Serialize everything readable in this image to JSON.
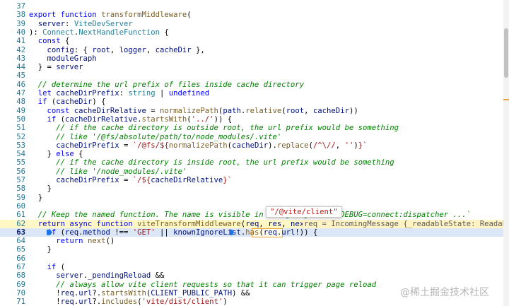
{
  "tooltip": {
    "text": "\"/@vite/client\""
  },
  "inline_value": "req = IncomingMessage {_readableState: ReadableSt",
  "watermark": "@稀土掘金技术社区",
  "icons": {
    "breakpoint": "breakpoint-arrow-icon",
    "scroll": "scrollbar"
  },
  "colors": {
    "keyword": "#0000ff",
    "function": "#795e26",
    "type": "#267f99",
    "identifier": "#001080",
    "string": "#a31515",
    "comment": "#008000",
    "line_number": "#237893",
    "current_line": "#dbe6f6",
    "paused_line": "#fff8c5"
  },
  "lines": [
    {
      "n": "37",
      "t": []
    },
    {
      "n": "38",
      "t": [
        [
          "kw",
          "export function "
        ],
        [
          "fn",
          "transformMiddleware"
        ],
        [
          "pl",
          "("
        ]
      ]
    },
    {
      "n": "39",
      "t": [
        [
          "pl",
          "  "
        ],
        [
          "id",
          "server"
        ],
        [
          "pl",
          ": "
        ],
        [
          "ty",
          "ViteDevServer"
        ]
      ]
    },
    {
      "n": "40",
      "t": [
        [
          "pl",
          "): "
        ],
        [
          "ty",
          "Connect"
        ],
        [
          "pl",
          "."
        ],
        [
          "ty",
          "NextHandleFunction"
        ],
        [
          "pl",
          " {"
        ]
      ]
    },
    {
      "n": "41",
      "t": [
        [
          "pl",
          "  "
        ],
        [
          "kw",
          "const"
        ],
        [
          "pl",
          " {"
        ]
      ]
    },
    {
      "n": "42",
      "t": [
        [
          "pl",
          "    "
        ],
        [
          "id",
          "config"
        ],
        [
          "pl",
          ": { "
        ],
        [
          "id",
          "root"
        ],
        [
          "pl",
          ", "
        ],
        [
          "id",
          "logger"
        ],
        [
          "pl",
          ", "
        ],
        [
          "id",
          "cacheDir"
        ],
        [
          "pl",
          " },"
        ]
      ]
    },
    {
      "n": "43",
      "t": [
        [
          "pl",
          "    "
        ],
        [
          "id",
          "moduleGraph"
        ]
      ]
    },
    {
      "n": "44",
      "t": [
        [
          "pl",
          "  } = "
        ],
        [
          "id",
          "server"
        ]
      ]
    },
    {
      "n": "45",
      "t": []
    },
    {
      "n": "46",
      "t": [
        [
          "pl",
          "  "
        ],
        [
          "cm",
          "// determine the url prefix of files inside cache directory"
        ]
      ]
    },
    {
      "n": "47",
      "t": [
        [
          "pl",
          "  "
        ],
        [
          "kw",
          "let "
        ],
        [
          "id",
          "cacheDirPrefix"
        ],
        [
          "pl",
          ": "
        ],
        [
          "ty",
          "string"
        ],
        [
          "pl",
          " | "
        ],
        [
          "kw",
          "undefined"
        ]
      ]
    },
    {
      "n": "48",
      "t": [
        [
          "pl",
          "  "
        ],
        [
          "kw",
          "if"
        ],
        [
          "pl",
          " ("
        ],
        [
          "id",
          "cacheDir"
        ],
        [
          "pl",
          ") {"
        ]
      ]
    },
    {
      "n": "49",
      "t": [
        [
          "pl",
          "    "
        ],
        [
          "kw",
          "const "
        ],
        [
          "id",
          "cacheDirRelative"
        ],
        [
          "pl",
          " = "
        ],
        [
          "fn",
          "normalizePath"
        ],
        [
          "pl",
          "("
        ],
        [
          "id",
          "path"
        ],
        [
          "pl",
          "."
        ],
        [
          "fn",
          "relative"
        ],
        [
          "pl",
          "("
        ],
        [
          "id",
          "root"
        ],
        [
          "pl",
          ", "
        ],
        [
          "id",
          "cacheDir"
        ],
        [
          "pl",
          "))"
        ]
      ]
    },
    {
      "n": "50",
      "t": [
        [
          "pl",
          "    "
        ],
        [
          "kw",
          "if"
        ],
        [
          "pl",
          " ("
        ],
        [
          "id",
          "cacheDirRelative"
        ],
        [
          "pl",
          "."
        ],
        [
          "fn",
          "startsWith"
        ],
        [
          "pl",
          "("
        ],
        [
          "str",
          "'../'"
        ],
        [
          "pl",
          ")) {"
        ]
      ]
    },
    {
      "n": "51",
      "t": [
        [
          "pl",
          "      "
        ],
        [
          "cm",
          "// if the cache directory is outside root, the url prefix would be something"
        ]
      ]
    },
    {
      "n": "52",
      "t": [
        [
          "pl",
          "      "
        ],
        [
          "cm",
          "// like '/@fs/absolute/path/to/node_modules/.vite'"
        ]
      ]
    },
    {
      "n": "53",
      "t": [
        [
          "pl",
          "      "
        ],
        [
          "id",
          "cacheDirPrefix"
        ],
        [
          "pl",
          " = "
        ],
        [
          "str",
          "`/@fs/${"
        ],
        [
          "fn",
          "normalizePath"
        ],
        [
          "pl",
          "("
        ],
        [
          "id",
          "cacheDir"
        ],
        [
          "pl",
          ")."
        ],
        [
          "fn",
          "replace"
        ],
        [
          "pl",
          "("
        ],
        [
          "str",
          "/^\\//"
        ],
        [
          "pl",
          ", "
        ],
        [
          "str",
          "''"
        ],
        [
          "pl",
          ")"
        ],
        [
          "str",
          "}`"
        ]
      ]
    },
    {
      "n": "54",
      "t": [
        [
          "pl",
          "    } "
        ],
        [
          "kw",
          "else"
        ],
        [
          "pl",
          " {"
        ]
      ]
    },
    {
      "n": "55",
      "t": [
        [
          "pl",
          "      "
        ],
        [
          "cm",
          "// if the cache directory is inside root, the url prefix would be something"
        ]
      ]
    },
    {
      "n": "56",
      "t": [
        [
          "pl",
          "      "
        ],
        [
          "cm",
          "// like '/node_modules/.vite'"
        ]
      ]
    },
    {
      "n": "57",
      "t": [
        [
          "pl",
          "      "
        ],
        [
          "id",
          "cacheDirPrefix"
        ],
        [
          "pl",
          " = "
        ],
        [
          "str",
          "`/${"
        ],
        [
          "id",
          "cacheDirRelative"
        ],
        [
          "str",
          "}`"
        ]
      ]
    },
    {
      "n": "58",
      "t": [
        [
          "pl",
          "    }"
        ]
      ]
    },
    {
      "n": "59",
      "t": [
        [
          "pl",
          "  }"
        ]
      ]
    },
    {
      "n": "60",
      "t": []
    },
    {
      "n": "61",
      "t": [
        [
          "pl",
          "  "
        ],
        [
          "cm",
          "// Keep the named function. The name is visible in debug logs via `DEBUG=connect:dispatcher ...`"
        ]
      ]
    },
    {
      "n": "62",
      "t": [
        [
          "pl",
          "  "
        ],
        [
          "kw",
          "return async function "
        ],
        [
          "fn",
          "viteTransformMiddleware"
        ],
        [
          "pl",
          "("
        ],
        [
          "id",
          "req"
        ],
        [
          "pl",
          ", "
        ],
        [
          "id",
          "res"
        ],
        [
          "pl",
          ", "
        ],
        [
          "id",
          "next"
        ],
        [
          "pl",
          ") {"
        ]
      ]
    },
    {
      "n": "63",
      "t": [
        [
          "pl",
          "    "
        ],
        [
          "kw",
          "if"
        ],
        [
          "pl",
          " ("
        ],
        [
          "id",
          "req"
        ],
        [
          "pl",
          "."
        ],
        [
          "id",
          "method"
        ],
        [
          "pl",
          " !== "
        ],
        [
          "str",
          "'GET'"
        ],
        [
          "pl",
          " || "
        ],
        [
          "id",
          "knownIgnoreList"
        ],
        [
          "pl",
          "."
        ],
        [
          "fn",
          "has"
        ],
        [
          "pl",
          "("
        ],
        [
          "id",
          "req"
        ],
        [
          "pl",
          "."
        ],
        [
          "id",
          "url"
        ],
        [
          "pl",
          "!)) {"
        ]
      ]
    },
    {
      "n": "64",
      "t": [
        [
          "pl",
          "      "
        ],
        [
          "kw",
          "return "
        ],
        [
          "fn",
          "next"
        ],
        [
          "pl",
          "()"
        ]
      ]
    },
    {
      "n": "65",
      "t": [
        [
          "pl",
          "    }"
        ]
      ]
    },
    {
      "n": "66",
      "t": []
    },
    {
      "n": "67",
      "t": [
        [
          "pl",
          "    "
        ],
        [
          "kw",
          "if"
        ],
        [
          "pl",
          " ("
        ]
      ]
    },
    {
      "n": "68",
      "t": [
        [
          "pl",
          "      "
        ],
        [
          "id",
          "server"
        ],
        [
          "pl",
          "."
        ],
        [
          "id",
          "_pendingReload"
        ],
        [
          "pl",
          " &&"
        ]
      ]
    },
    {
      "n": "69",
      "t": [
        [
          "pl",
          "      "
        ],
        [
          "cm",
          "// always allow vite client requests so that it can trigger page reload"
        ]
      ]
    },
    {
      "n": "70",
      "t": [
        [
          "pl",
          "      !"
        ],
        [
          "id",
          "req"
        ],
        [
          "pl",
          "."
        ],
        [
          "id",
          "url"
        ],
        [
          "pl",
          "?."
        ],
        [
          "fn",
          "startsWith"
        ],
        [
          "pl",
          "("
        ],
        [
          "id",
          "CLIENT_PUBLIC_PATH"
        ],
        [
          "pl",
          ") &&"
        ]
      ]
    },
    {
      "n": "71",
      "t": [
        [
          "pl",
          "      !"
        ],
        [
          "id",
          "req"
        ],
        [
          "pl",
          "."
        ],
        [
          "id",
          "url"
        ],
        [
          "pl",
          "?."
        ],
        [
          "fn",
          "includes"
        ],
        [
          "pl",
          "("
        ],
        [
          "str",
          "'vite/dist/client'"
        ],
        [
          "pl",
          ")"
        ]
      ]
    }
  ]
}
